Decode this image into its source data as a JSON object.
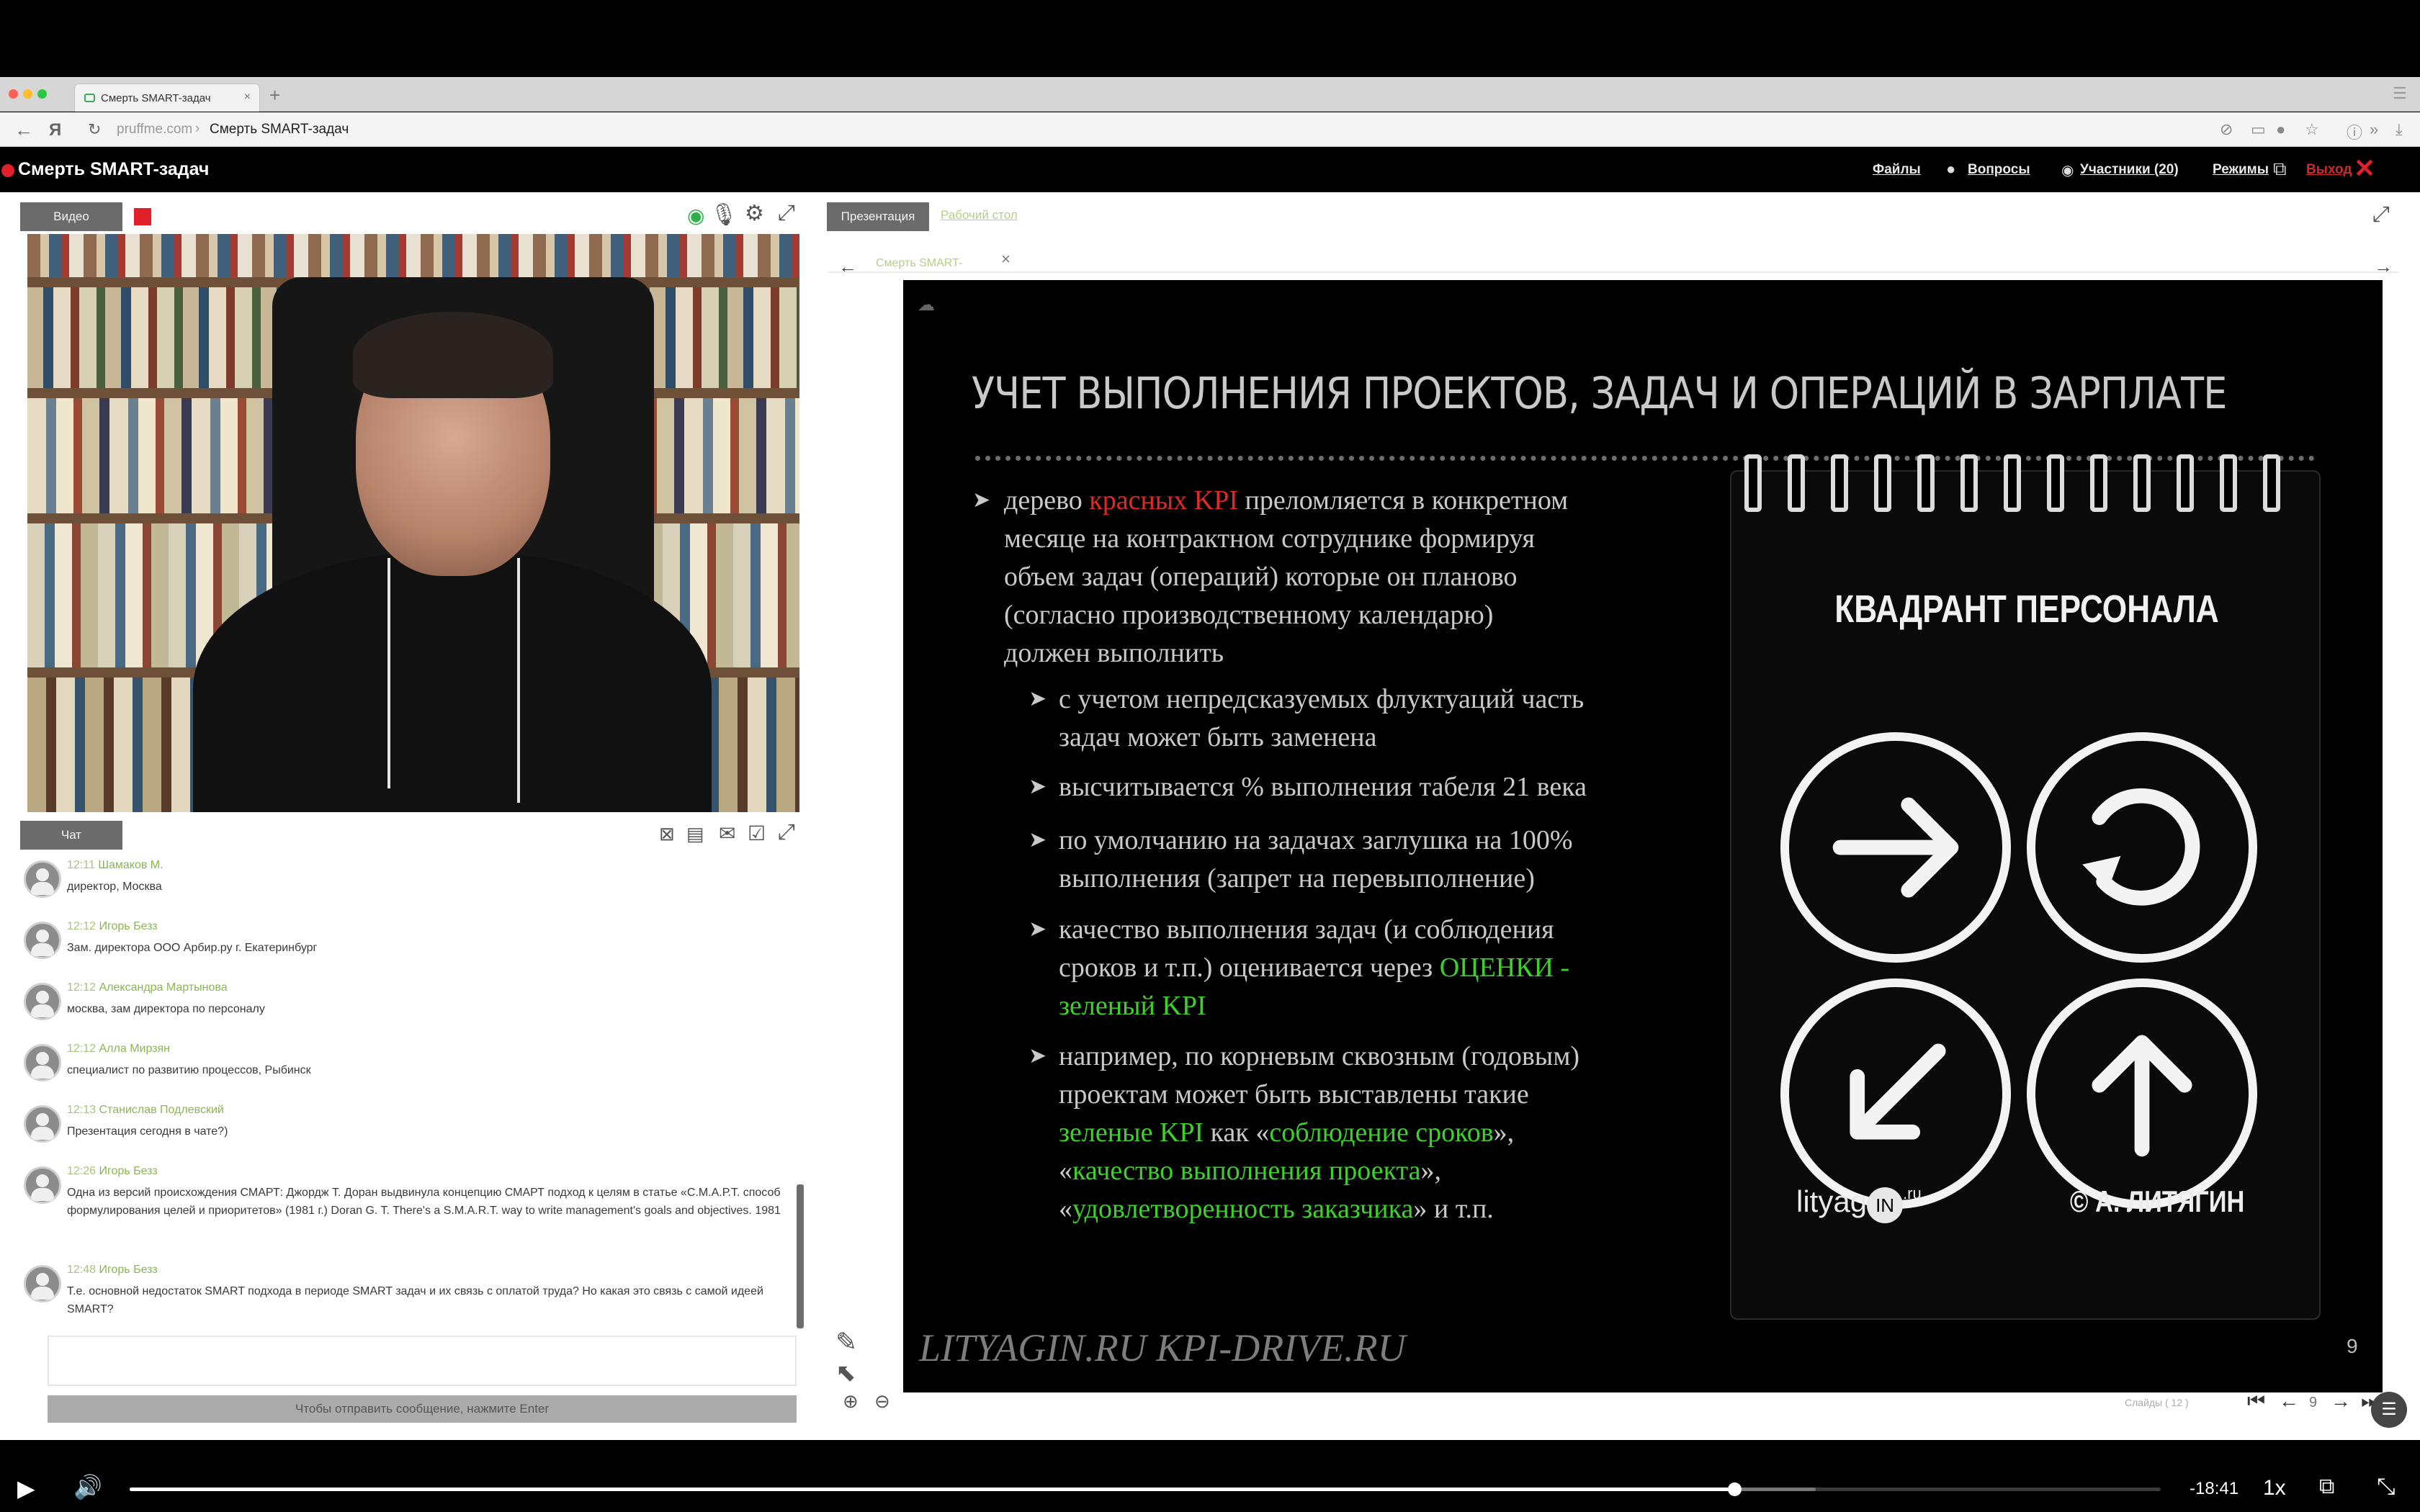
{
  "browser": {
    "tab_title": "Смерть SMART-задач",
    "tab_close": "×",
    "new_tab": "+",
    "back": "←",
    "reload": "↻",
    "yandex": "Я",
    "url_host": "pruffme.com",
    "url_sep": "›",
    "url_title": "Смерть SMART-задач"
  },
  "app": {
    "title": "Смерть SMART-задач",
    "nav": {
      "files": "Файлы",
      "questions": "Вопросы",
      "participants": "Участники (20)",
      "modes": "Режимы",
      "exit": "Выход"
    }
  },
  "video_panel": {
    "tab_label": "Видео"
  },
  "chat": {
    "tab_label": "Чат",
    "messages": [
      {
        "time": "12:11",
        "author": "Шамаков М.",
        "text": "директор, Москва"
      },
      {
        "time": "12:12",
        "author": "Игорь Безз",
        "text": "Зам. директора ООО Арбир.ру г. Екатеринбург"
      },
      {
        "time": "12:12",
        "author": "Александра Мартынова",
        "text": "москва, зам директора по персоналу"
      },
      {
        "time": "12:12",
        "author": "Алла Мирзян",
        "text": "специалист по развитию процессов, Рыбинск"
      },
      {
        "time": "12:13",
        "author": "Станислав Подлевский",
        "text": "Презентация сегодня в чате?)"
      },
      {
        "time": "12:26",
        "author": "Игорь Безз",
        "text": "Одна из версий происхождения СМАРТ: Джордж Т. Доран выдвинула концепцию СМАРТ подход к целям в статье «С.М.А.Р.Т. способ формулирования целей и приоритетов» (1981 г.) Doran G. T. There's a S.M.A.R.T. way to write management's goals and objectives. 1981"
      },
      {
        "time": "12:48",
        "author": "Игорь Безз",
        "text": "Т.е. основной недостаток SMART подхода в периоде SMART задач и их связь с оплатой труда? Но какая это связь с самой идеей SMART?"
      }
    ],
    "send_hint": "Чтобы отправить сообщение, нажмите Enter"
  },
  "presentation": {
    "tab_label": "Презентация",
    "desktop_tab": "Рабочий стол",
    "doc_tab": "Смерть SMART-",
    "doc_close": "×",
    "slide": {
      "heading": "УЧЕТ ВЫПОЛНЕНИЯ ПРОЕКТОВ, ЗАДАЧ И ОПЕРАЦИЙ В ЗАРПЛАТЕ",
      "b1_pre": "дерево ",
      "b1_red": "красных KPI",
      "b1_post": " преломляется в конкретном",
      "b1_l2": "месяце на контрактном сотруднике формируя",
      "b1_l3": "объем задач (операций) которые он планово",
      "b1_l4": "(согласно производственному календарю)",
      "b1_l5": "должен выполнить",
      "s1_l1": "с учетом непредсказуемых флуктуаций часть",
      "s1_l2": "задач может быть заменена",
      "s2": "высчитывается % выполнения табеля 21 века",
      "s3_l1": "по умолчанию на задачах заглушка на 100%",
      "s3_l2": "выполнения (запрет на перевыполнение)",
      "s4_l1": "качество выполнения задач (и соблюдения",
      "s4_l2_pre": "сроков и т.п.) оценивается через ",
      "s4_l2_green": "ОЦЕНКИ -",
      "s4_l3_green": "зеленый KPI",
      "s5_l1": "например, по корневым сквозным (годовым)",
      "s5_l2": "проектам может быть выставлены такие",
      "s5_l3_green1": "зеленые KPI",
      "s5_l3_mid": " как «",
      "s5_l3_green2": "соблюдение сроков",
      "s5_l3_end": "»,",
      "s5_l4_pre": "«",
      "s5_l4_green": "качество выполнения проекта",
      "s5_l4_end": "»,",
      "s5_l5_pre": "«",
      "s5_l5_green": "удовлетворенность заказчика",
      "s5_l5_end": "» и т.п.",
      "quad_title": "КВАДРАНТ ПЕРСОНАЛА",
      "logo": "lityag",
      "logo_in": "IN",
      "logo_ru": ".ru",
      "copyright": "© А. ЛИТЯГИН",
      "footer": "LITYAGIN.RU  KPI-DRIVE.RU",
      "page_number": "9"
    },
    "slides_counter": "Слайды ( 12 )",
    "current_page": "9"
  },
  "player": {
    "time_remaining": "-18:41",
    "speed": "1x",
    "progress": 0.79,
    "buffered": 0.83
  },
  "colors": {
    "accent_red": "#e02a24",
    "accent_green": "#3cd22a",
    "chat_author": "#8cb553"
  }
}
